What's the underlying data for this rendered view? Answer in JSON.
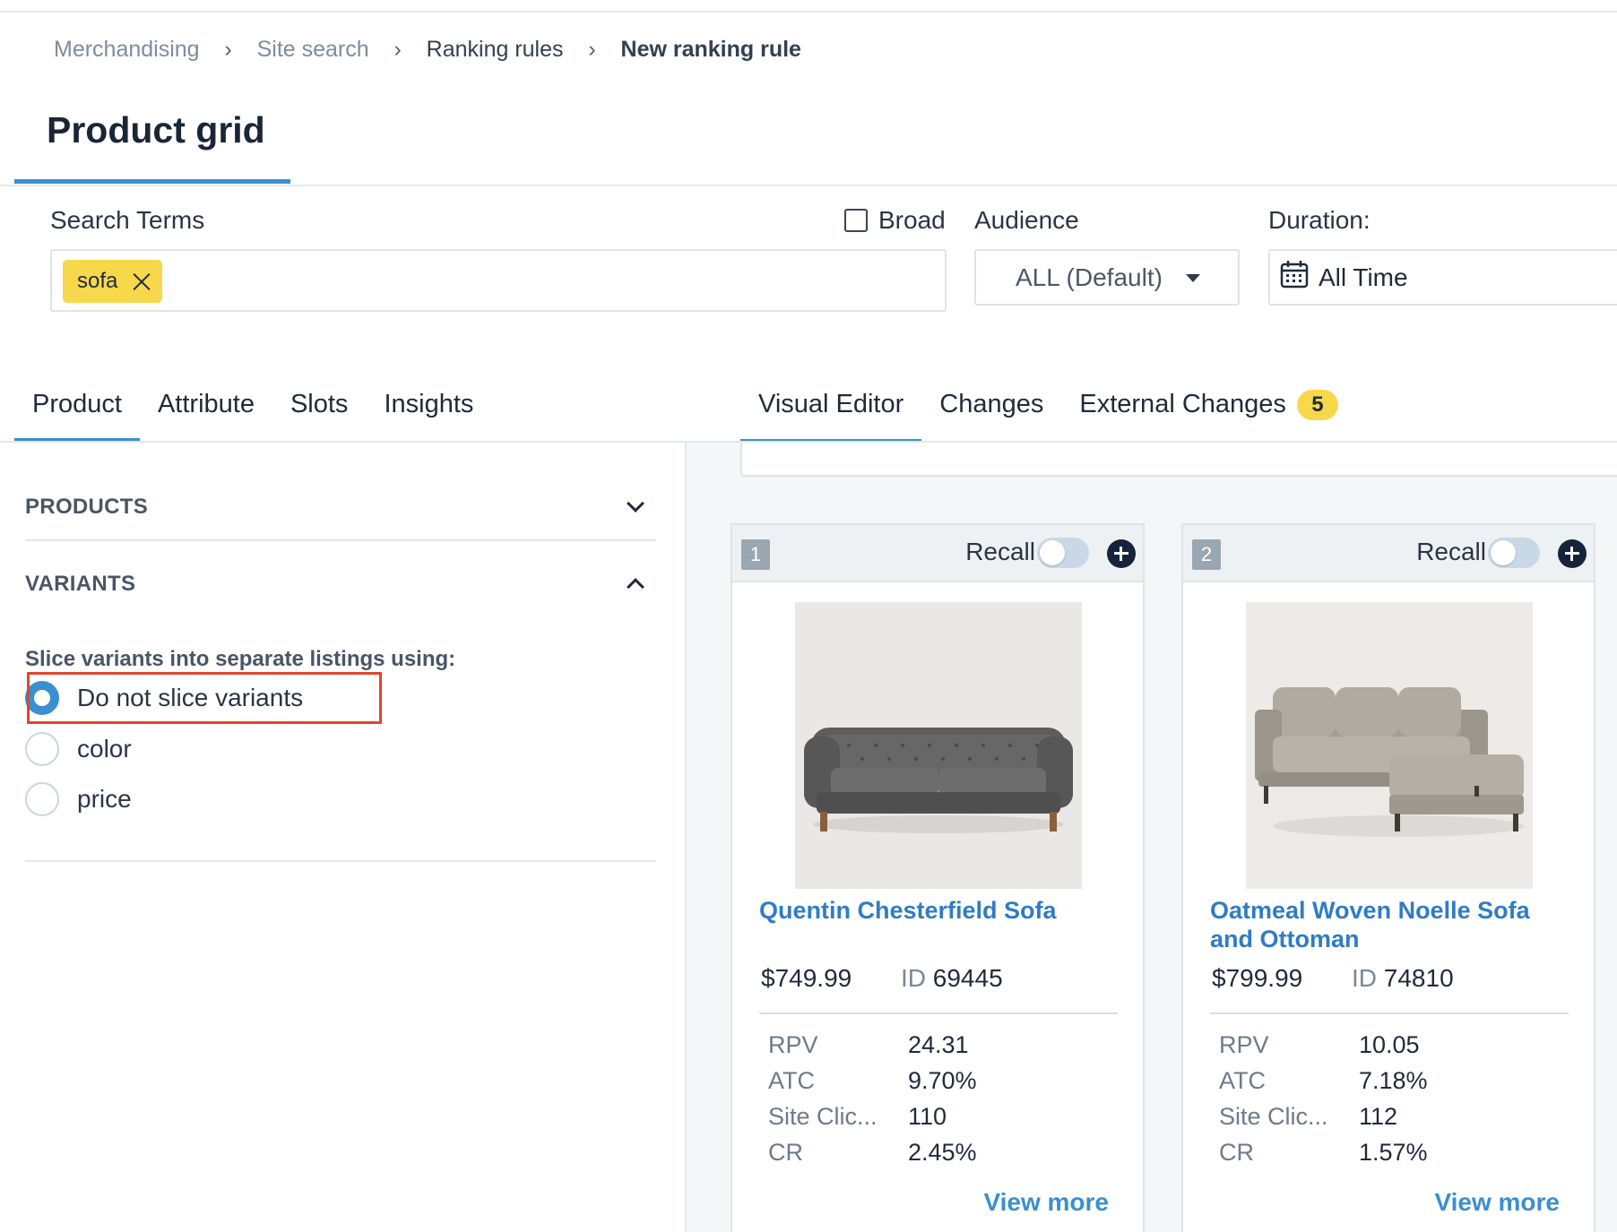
{
  "breadcrumb": [
    "Merchandising",
    "Site search",
    "Ranking rules",
    "New ranking rule"
  ],
  "page": {
    "title": "Product grid"
  },
  "search": {
    "label": "Search Terms",
    "chips": [
      "sofa"
    ],
    "broad_label": "Broad",
    "audience_label": "Audience",
    "audience_value": "ALL (Default)",
    "duration_label": "Duration:",
    "duration_value": "All Time"
  },
  "left_tabs": [
    "Product",
    "Attribute",
    "Slots",
    "Insights"
  ],
  "right_tabs": [
    "Visual Editor",
    "Changes",
    "External Changes"
  ],
  "external_changes_count": "5",
  "accordion": {
    "products": "PRODUCTS",
    "variants": "VARIANTS"
  },
  "variants": {
    "prompt": "Slice variants into separate listings using:",
    "options": [
      "Do not slice variants",
      "color",
      "price"
    ],
    "selected": "Do not slice variants"
  },
  "cards": [
    {
      "rank": "1",
      "recall": "Recall",
      "name": "Quentin Chesterfield Sofa",
      "price": "$749.99",
      "id_label": "ID",
      "id": "69445",
      "metrics": [
        {
          "k": "RPV",
          "v": "24.31"
        },
        {
          "k": "ATC",
          "v": "9.70%"
        },
        {
          "k": "Site Clic...",
          "v": "110"
        },
        {
          "k": "CR",
          "v": "2.45%"
        }
      ],
      "view_more": "View more"
    },
    {
      "rank": "2",
      "recall": "Recall",
      "name": "Oatmeal Woven Noelle Sofa and Ottoman",
      "price": "$799.99",
      "id_label": "ID",
      "id": "74810",
      "metrics": [
        {
          "k": "RPV",
          "v": "10.05"
        },
        {
          "k": "ATC",
          "v": "7.18%"
        },
        {
          "k": "Site Clic...",
          "v": "112"
        },
        {
          "k": "CR",
          "v": "1.57%"
        }
      ],
      "view_more": "View more"
    }
  ],
  "colors": {
    "accent": "#3a8fcf",
    "chip": "#f7d84b",
    "highlight": "#e0452c",
    "link": "#2f7cc4"
  }
}
